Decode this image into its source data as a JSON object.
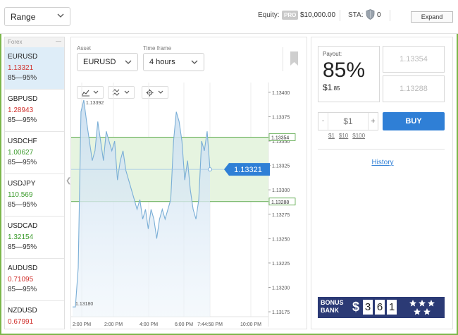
{
  "topbar": {
    "mode": "Range",
    "equity_label": "Equity:",
    "pro_badge": "PRO",
    "equity_value": "$10,000.00",
    "sta_label": "STA:",
    "sta_value": "0",
    "expand_label": "Expand"
  },
  "asset_list": {
    "header": "Forex",
    "header_control": "—",
    "items": [
      {
        "symbol": "EURUSD",
        "price": "1.13321",
        "trend": "down",
        "range": "85—95%",
        "active": true
      },
      {
        "symbol": "GBPUSD",
        "price": "1.28943",
        "trend": "down",
        "range": "85—95%"
      },
      {
        "symbol": "USDCHF",
        "price": "1.00627",
        "trend": "up",
        "range": "85—95%"
      },
      {
        "symbol": "USDJPY",
        "price": "110.569",
        "trend": "up",
        "range": "85—95%"
      },
      {
        "symbol": "USDCAD",
        "price": "1.32154",
        "trend": "up",
        "range": "85—95%"
      },
      {
        "symbol": "AUDUSD",
        "price": "0.71095",
        "trend": "down",
        "range": "85—95%"
      },
      {
        "symbol": "NZDUSD",
        "price": "0.67991",
        "trend": "down",
        "range": ""
      }
    ]
  },
  "controls": {
    "asset_label": "Asset",
    "asset_value": "EURUSD",
    "timeframe_label": "Time frame",
    "timeframe_value": "4 hours"
  },
  "colors": {
    "accent": "#2f7fd6",
    "range_band": "#e6f4e0",
    "range_line": "#5aa84a",
    "price_line": "#7aaed6",
    "down": "#d0312d",
    "up": "#3a9a2a"
  },
  "chart_data": {
    "type": "area",
    "x_ticks": [
      "2:00 PM",
      "2:00 PM",
      "4:00 PM",
      "6:00 PM",
      "7:44:58 PM",
      "10:00 PM"
    ],
    "y_ticks": [
      1.134,
      1.13375,
      1.1335,
      1.13325,
      1.133,
      1.13275,
      1.1325,
      1.13225,
      1.132,
      1.13175
    ],
    "ylim": [
      1.1317,
      1.1341
    ],
    "range_upper": 1.13354,
    "range_upper_label": "1.13354",
    "range_lower": 1.13288,
    "range_lower_label": "1.13288",
    "current_price": 1.13321,
    "current_price_label": "1.13321",
    "high_label": "1.13392",
    "low_label": "1.13180",
    "series": [
      {
        "values": [
          1.1318,
          1.1318,
          1.1322,
          1.1338,
          1.13392,
          1.1337,
          1.1335,
          1.1333,
          1.1334,
          1.1337,
          1.1335,
          1.1333,
          1.1336,
          1.1335,
          1.1334,
          1.1335,
          1.1331,
          1.1333,
          1.1334,
          1.1332,
          1.1331,
          1.133,
          1.1329,
          1.1328,
          1.1329,
          1.1327,
          1.1328,
          1.1326,
          1.1328,
          1.1327,
          1.1325,
          1.1327,
          1.1328,
          1.1327,
          1.1328,
          1.1329,
          1.1335,
          1.1338,
          1.1337,
          1.1335,
          1.1331,
          1.1333,
          1.133,
          1.1328,
          1.1327,
          1.1329,
          1.1335,
          1.1334,
          1.1336,
          1.13321
        ]
      }
    ]
  },
  "trade": {
    "payout_label": "Payout:",
    "payout_pct": "85%",
    "payout_amount": "$1",
    "payout_cents": ".85",
    "upper_quote": "1.13354",
    "lower_quote": "1.13288",
    "amount_minus": "-",
    "amount_value": "$1",
    "amount_plus": "+",
    "quick_amounts": [
      "$1",
      "$10",
      "$100"
    ],
    "buy_label": "BUY",
    "history_label": "History"
  },
  "bonus": {
    "line1": "BONUS",
    "line2": "BANK",
    "currency": "$",
    "digits": [
      "3",
      "6",
      "1"
    ]
  }
}
